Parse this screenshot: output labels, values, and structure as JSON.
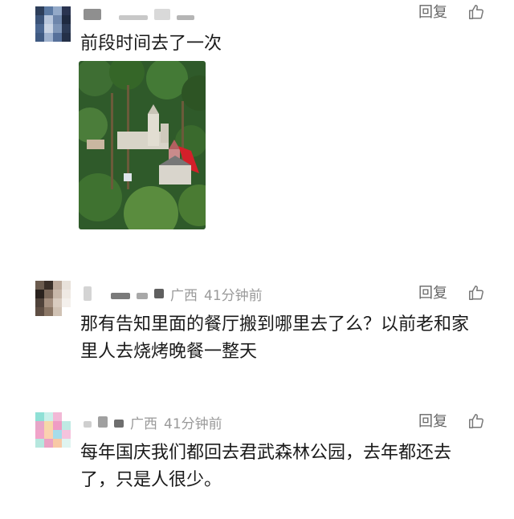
{
  "comments": [
    {
      "reply_label": "回复",
      "location": "",
      "time": "",
      "text": "前段时间去了一次",
      "image_alt": "aerial view of a castle-like building among forest trees"
    },
    {
      "reply_label": "回复",
      "location": "广西",
      "time": "41分钟前",
      "text": "那有告知里面的餐厅搬到哪里去了么？以前老和家里人去烧烤晚餐一整天"
    },
    {
      "reply_label": "回复",
      "location": "广西",
      "time": "41分钟前",
      "text": "每年国庆我们都回去君武森林公园，去年都还去了，只是人很少。"
    }
  ],
  "icons": {
    "like": "thumbs-up-icon"
  },
  "colors": {
    "meta": "#9a9a9a",
    "text": "#1a1a1a",
    "reply": "#666666"
  }
}
